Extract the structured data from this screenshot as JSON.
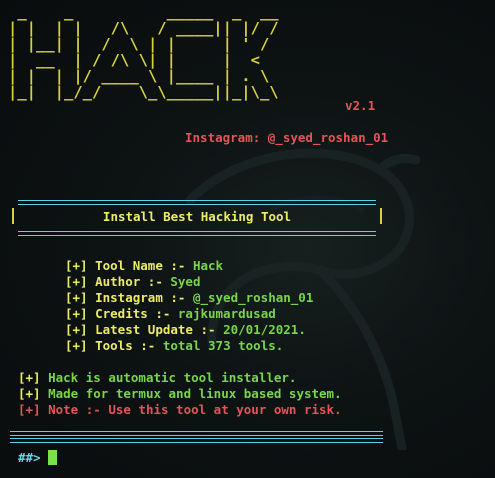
{
  "banner": {
    "ascii_art": " _    _          _____  _  __\n| |  | |   /\\   / ____|| |/ /\n| |__| |  /  \\ | |     | ' / \n|  __  | / /\\ \\| |     |  <  \n| |  | |/ ____ \\ |____ | . \\ \n|_|  |_/_/    \\_\\_____||_|\\_\\",
    "version": "v2.1",
    "instagram": "Instagram: @_syed_roshan_01"
  },
  "header": {
    "title": "Install Best Hacking Tool"
  },
  "info": [
    {
      "prefix": "[+]",
      "label": "Tool Name :-",
      "value": "Hack"
    },
    {
      "prefix": "[+]",
      "label": "Author :-",
      "value": "Syed"
    },
    {
      "prefix": "[+]",
      "label": "Instagram :-",
      "value": "@_syed_roshan_01"
    },
    {
      "prefix": "[+]",
      "label": "Credits :-",
      "value": "rajkumardusad"
    },
    {
      "prefix": "[+]",
      "label": "Latest Update :-",
      "value": "20/01/2021."
    },
    {
      "prefix": "[+]",
      "label": "Tools :-",
      "value": "total 373 tools."
    }
  ],
  "notes": [
    {
      "prefix": "[+]",
      "text": "Hack is automatic tool installer."
    },
    {
      "prefix": "[+]",
      "text": "Made for termux and linux based system."
    },
    {
      "prefix": "[+]",
      "text": "Note :- Use this tool at your own risk."
    }
  ],
  "prompt": "##>",
  "colors": {
    "background": "#0b0f10",
    "banner_yellow": "#d8d23a",
    "text_yellow": "#ecec6a",
    "green": "#79d44e",
    "cyan": "#6ad7ea",
    "red": "#e2555a",
    "cursor": "#79e24a"
  }
}
